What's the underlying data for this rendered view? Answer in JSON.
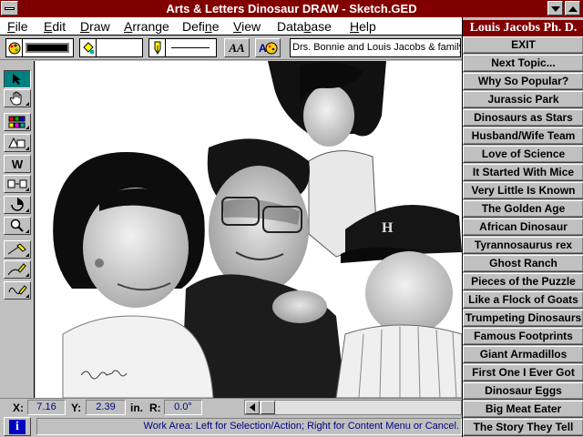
{
  "window": {
    "title": "Arts & Letters Dinosaur DRAW - Sketch.GED"
  },
  "menu": {
    "items": [
      {
        "accel": "F",
        "rest": "ile"
      },
      {
        "accel": "E",
        "rest": "dit"
      },
      {
        "accel": "D",
        "rest": "raw"
      },
      {
        "accel": "A",
        "rest": "rrange"
      },
      {
        "accel": "",
        "pre": "Defi",
        "mid": "n",
        "rest": "e"
      },
      {
        "accel": "V",
        "rest": "iew"
      },
      {
        "accel": "",
        "pre": "Data",
        "mid": "b",
        "rest": "ase"
      },
      {
        "accel": "H",
        "rest": "elp"
      }
    ]
  },
  "toolbar": {
    "font_button_label": "AA",
    "banner_text": "Drs. Bonnie and Louis Jacobs & family"
  },
  "toolbox": {
    "tools": [
      "selection-arrow",
      "hand-grab",
      "symbols-library",
      "shapes",
      "W",
      "text-box",
      "rotate",
      "zoom",
      "line-draw",
      "pencil-draw",
      "freehand-draw"
    ]
  },
  "topics_panel": {
    "title": "Louis Jacobs Ph. D.",
    "buttons": [
      "EXIT",
      "Next Topic...",
      "Why So Popular?",
      "Jurassic Park",
      "Dinosaurs as Stars",
      "Husband/Wife Team",
      "Love of Science",
      "It Started With Mice",
      "Very Little Is Known",
      "The Golden Age",
      "African Dinosaur",
      "Tyrannosaurus rex",
      "Ghost Ranch",
      "Pieces of the Puzzle",
      "Like a Flock of Goats",
      "Trumpeting Dinosaurs",
      "Famous Footprints",
      "Giant Armadillos",
      "First One I Ever Got",
      "Dinosaur Eggs",
      "Big Meat Eater",
      "The Story They Tell"
    ]
  },
  "status": {
    "x_label": "X:",
    "x_value": "7.16",
    "y_label": "Y:",
    "y_value": "2.39",
    "unit": "in.",
    "r_label": "R:",
    "r_value": "0.0°"
  },
  "message": "Work Area: Left for Selection/Action; Right for Content Menu or Cancel.",
  "info_button_label": "i",
  "colors": {
    "title_bar": "#800000",
    "panel_bg": "#c0c0c0",
    "status_text": "#000080",
    "active_tool": "#008080"
  }
}
